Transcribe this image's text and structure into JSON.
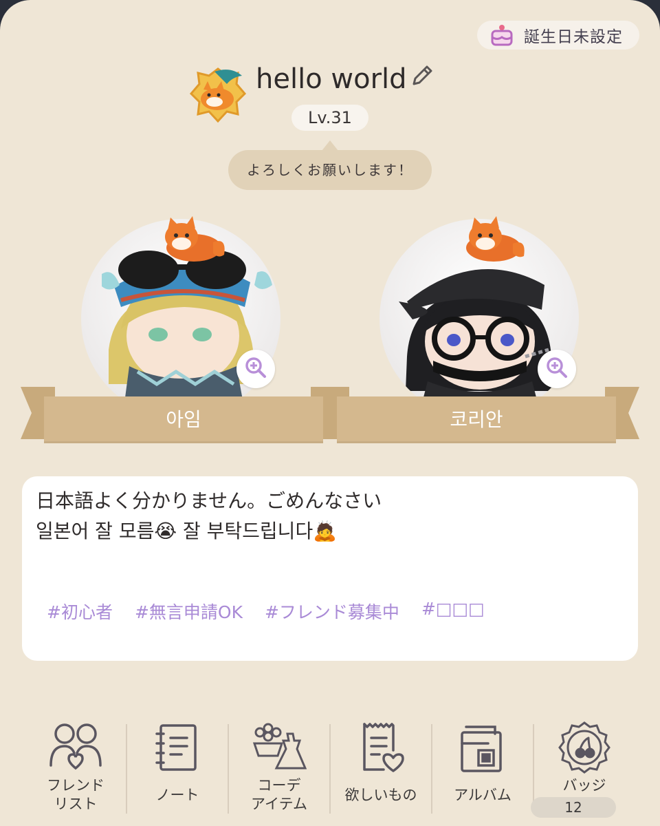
{
  "header": {
    "birthday_button_label": "誕生日未設定",
    "username": "hello world",
    "level": "Lv.31",
    "greeting": "よろしくお願いします！"
  },
  "avatars": [
    {
      "name": "아임"
    },
    {
      "name": "코리안"
    }
  ],
  "description": {
    "line1": "日本語よく分かりません。ごめんなさい",
    "line2": "일본어 잘 모름😭 잘 부탁드립니다🙇"
  },
  "tags": [
    "#初心者",
    "#無言申請OK",
    "#フレンド募集中",
    "#□□□"
  ],
  "menu": [
    {
      "label": "フレンド\nリスト",
      "icon": "friends-icon"
    },
    {
      "label": "ノート",
      "icon": "notebook-icon"
    },
    {
      "label": "コーデ\nアイテム",
      "icon": "outfit-items-icon"
    },
    {
      "label": "欲しいもの",
      "icon": "wishlist-icon"
    },
    {
      "label": "アルバム",
      "icon": "album-icon"
    },
    {
      "label": "バッジ",
      "icon": "badge-icon",
      "count": "12"
    }
  ],
  "colors": {
    "background": "#efe6d6",
    "ribbon": "#d4b88e",
    "tag": "#a98ad6",
    "accent": "#b88fd8"
  }
}
